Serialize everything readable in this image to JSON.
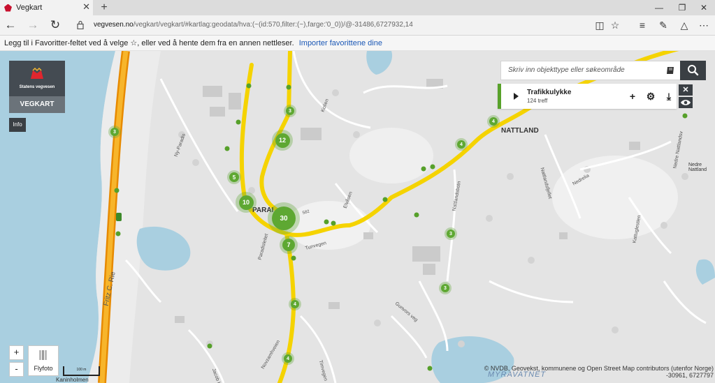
{
  "browser": {
    "tab_title": "Vegkart",
    "tab_close": "✕",
    "new_tab": "+",
    "url_host": "vegvesen.no",
    "url_path": "/vegkart/vegkart/#kartlag:geodata/hva:(~(id:570,filter:(~),farge:'0_0))/@-31486,6727932,14",
    "favorites_hint": "Legg til i Favoritter-feltet ved å velge ☆, eller ved å hente dem fra en annen nettleser.",
    "favorites_link": "Importer favorittene dine"
  },
  "app": {
    "logo_text": "Statens vegvesen",
    "vegkart_label": "VEGKART",
    "info_label": "Info",
    "search_placeholder": "Skriv inn objekttype eller søkeområde",
    "layer_title": "Trafikkulykke",
    "layer_count": "124 treff",
    "zoom_in": "+",
    "zoom_out": "-",
    "flyfoto_label": "Flyfoto",
    "scale_label": "100 m",
    "attribution": "© NVDB, Geovekst, kommunene og Open Street Map contributors (utenfor Norge)",
    "coordinates": "-30961, 6727797"
  },
  "map": {
    "places": {
      "nattland": "NATTLAND",
      "paradis": "PARAI",
      "myravatnet": "MYRAVATNET",
      "nedre_nattland": "Nedre\nNattland",
      "kaninholmen": "Kaninholmen"
    },
    "streets": {
      "fritz": "Fritz C. Rie",
      "ny_paradis": "Ny-Paradis",
      "kolien": "Kolien",
      "elvasen": "Elvåsen",
      "nattlandsbotn": "Nattlandsbotn",
      "nattlandsfjellet": "Nattlandsfjellet",
      "nedrela": "Nedrelia",
      "nedre_nattlandsv": "Nedre Nattlandsv",
      "kattuglestien": "Kattuglestien",
      "paradisleitet": "Paradisleitet",
      "tunvegen": "Tunvegen",
      "gunvors": "Gunvors veg",
      "jacob": "Jacob Kjøde",
      "novzanhveien": "Novzamhveien",
      "timvegen": "Timvegen",
      "road582": "582"
    },
    "clusters": [
      {
        "label": "3"
      },
      {
        "label": "12"
      },
      {
        "label": "5"
      },
      {
        "label": "10"
      },
      {
        "label": "30"
      },
      {
        "label": "7"
      },
      {
        "label": "4"
      },
      {
        "label": "4"
      },
      {
        "label": "3"
      },
      {
        "label": "3"
      },
      {
        "label": "4"
      },
      {
        "label": "4"
      },
      {
        "label": "3"
      }
    ]
  }
}
